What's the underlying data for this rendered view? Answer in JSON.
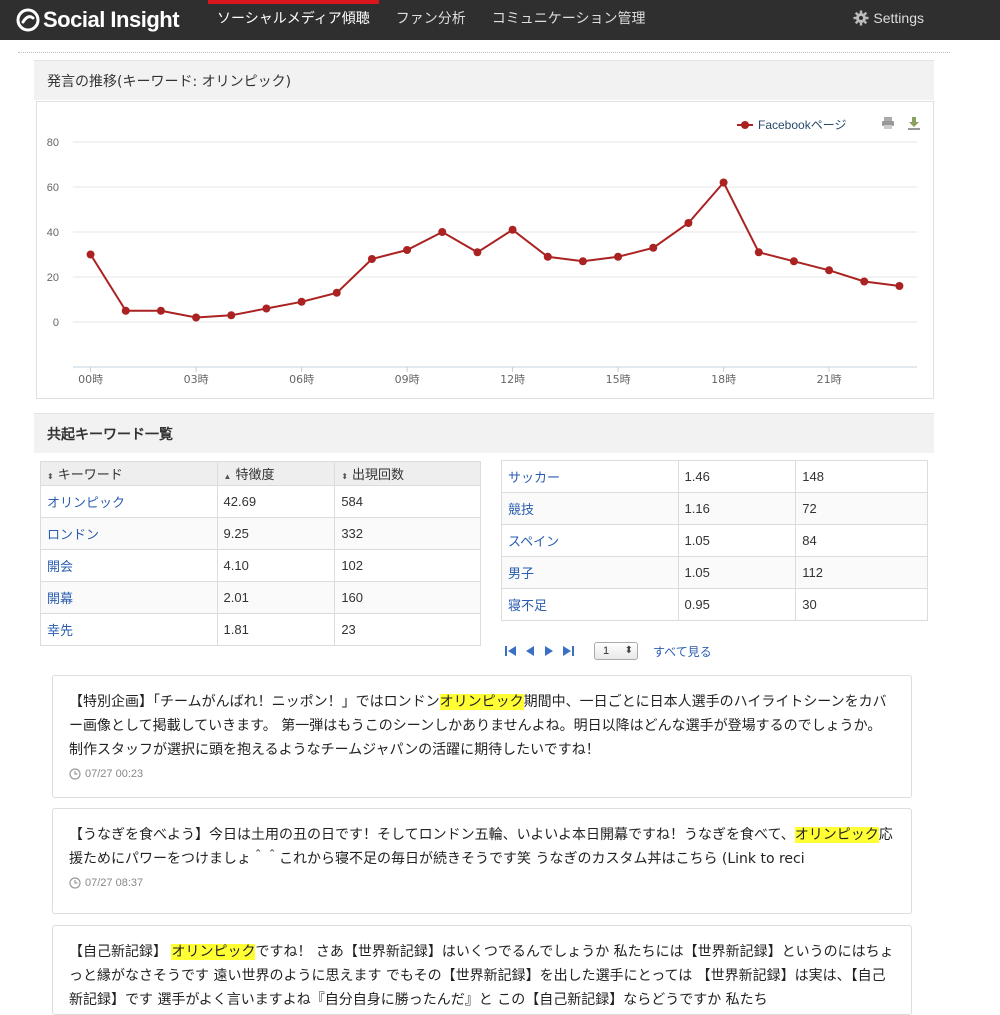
{
  "header": {
    "logo_text": "Social Insight",
    "nav": [
      {
        "label": "ソーシャルメディア傾聴",
        "active": true
      },
      {
        "label": "ファン分析",
        "active": false
      },
      {
        "label": "コミュニケーション管理",
        "active": false
      }
    ],
    "settings_label": "Settings"
  },
  "trend": {
    "title": "発言の推移(キーワード: オリンピック)"
  },
  "chart_data": {
    "type": "line",
    "title": "",
    "xlabel": "",
    "ylabel": "",
    "x": [
      "00時",
      "01時",
      "02時",
      "03時",
      "04時",
      "05時",
      "06時",
      "07時",
      "08時",
      "09時",
      "10時",
      "11時",
      "12時",
      "13時",
      "14時",
      "15時",
      "16時",
      "17時",
      "18時",
      "19時",
      "20時",
      "21時",
      "22時",
      "23時"
    ],
    "x_tick_labels": [
      "00時",
      "03時",
      "06時",
      "09時",
      "12時",
      "15時",
      "18時",
      "21時"
    ],
    "y_ticks": [
      0,
      20,
      40,
      60,
      80
    ],
    "ylim": [
      -20,
      80
    ],
    "series": [
      {
        "name": "Facebookページ",
        "color": "#aa2222",
        "values": [
          30,
          5,
          5,
          2,
          3,
          6,
          9,
          13,
          28,
          32,
          40,
          31,
          41,
          29,
          27,
          29,
          33,
          44,
          62,
          31,
          27,
          23,
          18,
          16
        ]
      }
    ],
    "legend_position": "top-right",
    "grid": true
  },
  "cooccur": {
    "title": "共起キーワード一覧",
    "headers": {
      "keyword": "キーワード",
      "score": "特徴度",
      "count": "出現回数"
    },
    "left_rows": [
      {
        "keyword": "オリンピック",
        "score": "42.69",
        "count": "584"
      },
      {
        "keyword": "ロンドン",
        "score": "9.25",
        "count": "332"
      },
      {
        "keyword": "開会",
        "score": "4.10",
        "count": "102"
      },
      {
        "keyword": "開幕",
        "score": "2.01",
        "count": "160"
      },
      {
        "keyword": "幸先",
        "score": "1.81",
        "count": "23"
      }
    ],
    "right_rows": [
      {
        "keyword": "サッカー",
        "score": "1.46",
        "count": "148"
      },
      {
        "keyword": "競技",
        "score": "1.16",
        "count": "72"
      },
      {
        "keyword": "スペイン",
        "score": "1.05",
        "count": "84"
      },
      {
        "keyword": "男子",
        "score": "1.05",
        "count": "112"
      },
      {
        "keyword": "寝不足",
        "score": "0.95",
        "count": "30"
      }
    ],
    "page_select": "1",
    "see_all": "すべて見る"
  },
  "posts": [
    {
      "parts": [
        {
          "t": "【特別企画】「チームがんばれ！ニッポン！」ではロンドン"
        },
        {
          "t": "オリンピック",
          "hl": true
        },
        {
          "t": "期間中、一日ごとに日本人選手のハイライトシーンをカバー画像として掲載していきます。 第一弾はもうこのシーンしかありませんよね。明日以降はどんな選手が登場するのでしょうか。制作スタッフが選択に頭を抱えるようなチームジャパンの活躍に期待したいですね！"
        }
      ],
      "time": "07/27 00:23"
    },
    {
      "parts": [
        {
          "t": "【うなぎを食べよう】今日は土用の丑の日です！そしてロンドン五輪、いよいよ本日開幕ですね！うなぎを食べて、"
        },
        {
          "t": "オリンピック",
          "hl": true
        },
        {
          "t": "応援ためにパワーをつけましょ＾＾これから寝不足の毎日が続きそうです笑 うなぎのカスタム丼はこちら (Link to reci"
        }
      ],
      "time": "07/27 08:37"
    },
    {
      "parts": [
        {
          "t": "【自己新記録】 "
        },
        {
          "t": "オリンピック",
          "hl": true
        },
        {
          "t": "ですね！ さあ【世界新記録】はいくつでるんでしょうか 私たちには【世界新記録】というのにはちょっと縁がなさそうです 遠い世界のように思えます でもその【世界新記録】を出した選手にとっては 【世界新記録】は実は、【自己新記録】です 選手がよく言いますよね『自分自身に勝ったんだ』と この【自己新記録】ならどうですか 私たち"
        }
      ],
      "time": ""
    }
  ]
}
